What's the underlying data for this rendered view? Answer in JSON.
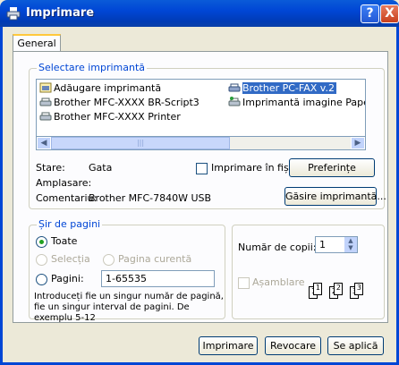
{
  "window": {
    "title": "Imprimare",
    "help": "?",
    "close": "X"
  },
  "tabs": [
    {
      "label": "General"
    }
  ],
  "printer_group": {
    "legend": "Selectare imprimantă",
    "printers": [
      {
        "label": "Adăugare imprimantă",
        "icon": "add-printer-icon"
      },
      {
        "label": "Brother MFC-XXXX  BR-Script3",
        "icon": "printer-icon"
      },
      {
        "label": "Brother MFC-XXXX  Printer",
        "icon": "printer-icon"
      },
      {
        "label": "Brother PC-FAX v.2",
        "icon": "fax-printer-icon",
        "selected": true
      },
      {
        "label": "Imprimantă imagine PaperPort",
        "icon": "image-printer-icon"
      }
    ],
    "status_label": "Stare:",
    "status_value": "Gata",
    "location_label": "Amplasare:",
    "location_value": "",
    "comment_label": "Comentariu:",
    "comment_value": "Brother MFC-7840W USB",
    "print_to_file": "Imprimare în fișier",
    "print_to_file_checked": false,
    "preferences": "Preferințe",
    "find_printer": "Găsire imprimantă..."
  },
  "range_group": {
    "legend": "Șir de pagini",
    "all": "Toate",
    "selection": "Selecția",
    "current_page": "Pagina curentă",
    "pages": "Pagini:",
    "pages_value": "1-65535",
    "hint": "Introduceți fie un singur număr de pagină, fie un singur interval de pagini. De exemplu 5-12",
    "selected": "all"
  },
  "copies_group": {
    "copies_label": "Număr de copii:",
    "copies_value": "1",
    "collate": "Așamblare",
    "collate_checked": false
  },
  "footer": {
    "print": "Imprimare",
    "cancel": "Revocare",
    "apply": "Se aplică"
  },
  "colors": {
    "accent": "#0046d5",
    "selection": "#316ac5"
  }
}
